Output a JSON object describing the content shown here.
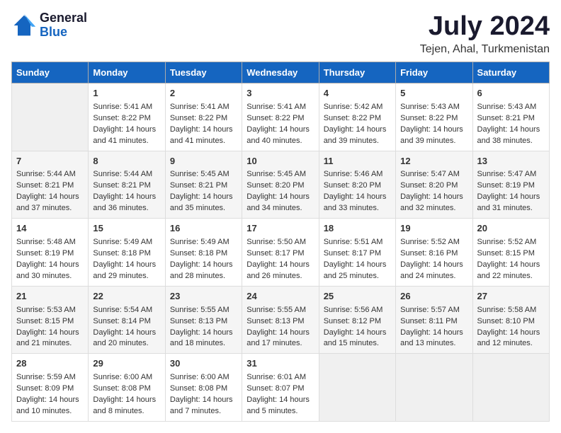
{
  "logo": {
    "line1": "General",
    "line2": "Blue"
  },
  "title": "July 2024",
  "subtitle": "Tejen, Ahal, Turkmenistan",
  "headers": [
    "Sunday",
    "Monday",
    "Tuesday",
    "Wednesday",
    "Thursday",
    "Friday",
    "Saturday"
  ],
  "weeks": [
    [
      {
        "day": "",
        "data": []
      },
      {
        "day": "1",
        "data": [
          "Sunrise: 5:41 AM",
          "Sunset: 8:22 PM",
          "Daylight: 14 hours",
          "and 41 minutes."
        ]
      },
      {
        "day": "2",
        "data": [
          "Sunrise: 5:41 AM",
          "Sunset: 8:22 PM",
          "Daylight: 14 hours",
          "and 41 minutes."
        ]
      },
      {
        "day": "3",
        "data": [
          "Sunrise: 5:41 AM",
          "Sunset: 8:22 PM",
          "Daylight: 14 hours",
          "and 40 minutes."
        ]
      },
      {
        "day": "4",
        "data": [
          "Sunrise: 5:42 AM",
          "Sunset: 8:22 PM",
          "Daylight: 14 hours",
          "and 39 minutes."
        ]
      },
      {
        "day": "5",
        "data": [
          "Sunrise: 5:43 AM",
          "Sunset: 8:22 PM",
          "Daylight: 14 hours",
          "and 39 minutes."
        ]
      },
      {
        "day": "6",
        "data": [
          "Sunrise: 5:43 AM",
          "Sunset: 8:21 PM",
          "Daylight: 14 hours",
          "and 38 minutes."
        ]
      }
    ],
    [
      {
        "day": "7",
        "data": [
          "Sunrise: 5:44 AM",
          "Sunset: 8:21 PM",
          "Daylight: 14 hours",
          "and 37 minutes."
        ]
      },
      {
        "day": "8",
        "data": [
          "Sunrise: 5:44 AM",
          "Sunset: 8:21 PM",
          "Daylight: 14 hours",
          "and 36 minutes."
        ]
      },
      {
        "day": "9",
        "data": [
          "Sunrise: 5:45 AM",
          "Sunset: 8:21 PM",
          "Daylight: 14 hours",
          "and 35 minutes."
        ]
      },
      {
        "day": "10",
        "data": [
          "Sunrise: 5:45 AM",
          "Sunset: 8:20 PM",
          "Daylight: 14 hours",
          "and 34 minutes."
        ]
      },
      {
        "day": "11",
        "data": [
          "Sunrise: 5:46 AM",
          "Sunset: 8:20 PM",
          "Daylight: 14 hours",
          "and 33 minutes."
        ]
      },
      {
        "day": "12",
        "data": [
          "Sunrise: 5:47 AM",
          "Sunset: 8:20 PM",
          "Daylight: 14 hours",
          "and 32 minutes."
        ]
      },
      {
        "day": "13",
        "data": [
          "Sunrise: 5:47 AM",
          "Sunset: 8:19 PM",
          "Daylight: 14 hours",
          "and 31 minutes."
        ]
      }
    ],
    [
      {
        "day": "14",
        "data": [
          "Sunrise: 5:48 AM",
          "Sunset: 8:19 PM",
          "Daylight: 14 hours",
          "and 30 minutes."
        ]
      },
      {
        "day": "15",
        "data": [
          "Sunrise: 5:49 AM",
          "Sunset: 8:18 PM",
          "Daylight: 14 hours",
          "and 29 minutes."
        ]
      },
      {
        "day": "16",
        "data": [
          "Sunrise: 5:49 AM",
          "Sunset: 8:18 PM",
          "Daylight: 14 hours",
          "and 28 minutes."
        ]
      },
      {
        "day": "17",
        "data": [
          "Sunrise: 5:50 AM",
          "Sunset: 8:17 PM",
          "Daylight: 14 hours",
          "and 26 minutes."
        ]
      },
      {
        "day": "18",
        "data": [
          "Sunrise: 5:51 AM",
          "Sunset: 8:17 PM",
          "Daylight: 14 hours",
          "and 25 minutes."
        ]
      },
      {
        "day": "19",
        "data": [
          "Sunrise: 5:52 AM",
          "Sunset: 8:16 PM",
          "Daylight: 14 hours",
          "and 24 minutes."
        ]
      },
      {
        "day": "20",
        "data": [
          "Sunrise: 5:52 AM",
          "Sunset: 8:15 PM",
          "Daylight: 14 hours",
          "and 22 minutes."
        ]
      }
    ],
    [
      {
        "day": "21",
        "data": [
          "Sunrise: 5:53 AM",
          "Sunset: 8:15 PM",
          "Daylight: 14 hours",
          "and 21 minutes."
        ]
      },
      {
        "day": "22",
        "data": [
          "Sunrise: 5:54 AM",
          "Sunset: 8:14 PM",
          "Daylight: 14 hours",
          "and 20 minutes."
        ]
      },
      {
        "day": "23",
        "data": [
          "Sunrise: 5:55 AM",
          "Sunset: 8:13 PM",
          "Daylight: 14 hours",
          "and 18 minutes."
        ]
      },
      {
        "day": "24",
        "data": [
          "Sunrise: 5:55 AM",
          "Sunset: 8:13 PM",
          "Daylight: 14 hours",
          "and 17 minutes."
        ]
      },
      {
        "day": "25",
        "data": [
          "Sunrise: 5:56 AM",
          "Sunset: 8:12 PM",
          "Daylight: 14 hours",
          "and 15 minutes."
        ]
      },
      {
        "day": "26",
        "data": [
          "Sunrise: 5:57 AM",
          "Sunset: 8:11 PM",
          "Daylight: 14 hours",
          "and 13 minutes."
        ]
      },
      {
        "day": "27",
        "data": [
          "Sunrise: 5:58 AM",
          "Sunset: 8:10 PM",
          "Daylight: 14 hours",
          "and 12 minutes."
        ]
      }
    ],
    [
      {
        "day": "28",
        "data": [
          "Sunrise: 5:59 AM",
          "Sunset: 8:09 PM",
          "Daylight: 14 hours",
          "and 10 minutes."
        ]
      },
      {
        "day": "29",
        "data": [
          "Sunrise: 6:00 AM",
          "Sunset: 8:08 PM",
          "Daylight: 14 hours",
          "and 8 minutes."
        ]
      },
      {
        "day": "30",
        "data": [
          "Sunrise: 6:00 AM",
          "Sunset: 8:08 PM",
          "Daylight: 14 hours",
          "and 7 minutes."
        ]
      },
      {
        "day": "31",
        "data": [
          "Sunrise: 6:01 AM",
          "Sunset: 8:07 PM",
          "Daylight: 14 hours",
          "and 5 minutes."
        ]
      },
      {
        "day": "",
        "data": []
      },
      {
        "day": "",
        "data": []
      },
      {
        "day": "",
        "data": []
      }
    ]
  ]
}
